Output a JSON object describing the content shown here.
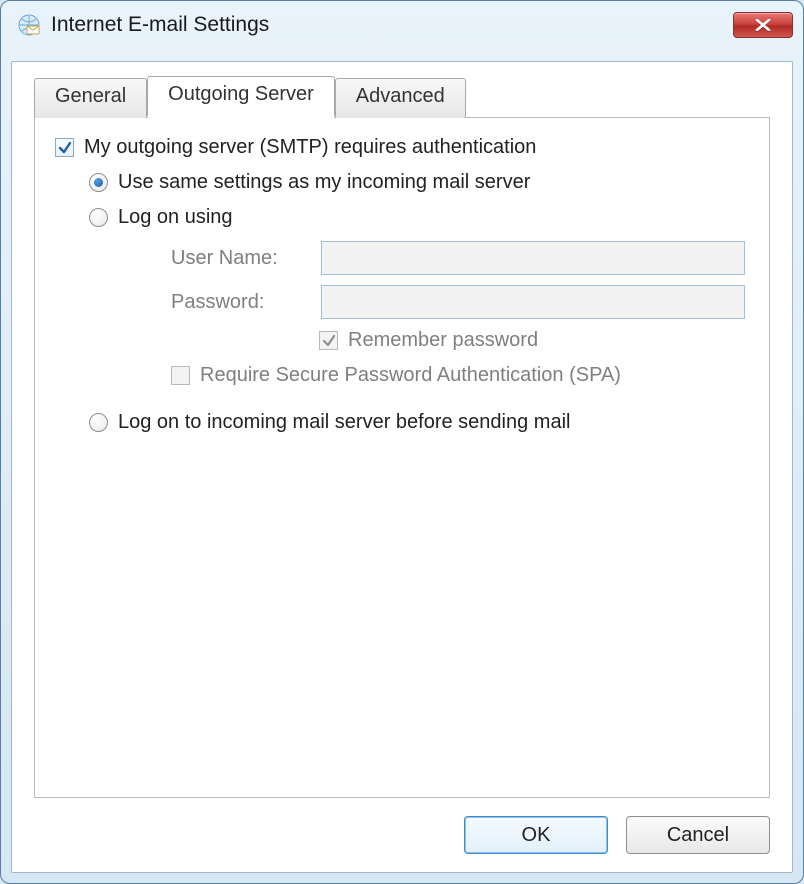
{
  "window": {
    "title": "Internet E-mail Settings"
  },
  "tabs": {
    "general": "General",
    "outgoing": "Outgoing Server",
    "advanced": "Advanced"
  },
  "outgoing_tab": {
    "requires_auth_label": "My outgoing server (SMTP) requires authentication",
    "requires_auth_checked": true,
    "option_same": "Use same settings as my incoming mail server",
    "option_logon": "Log on using",
    "option_logon_before": "Log on to incoming mail server before sending mail",
    "selected_option": "same",
    "username_label": "User Name:",
    "username_value": "",
    "password_label": "Password:",
    "password_value": "",
    "remember_label": "Remember password",
    "remember_checked": true,
    "spa_label": "Require Secure Password Authentication (SPA)",
    "spa_checked": false
  },
  "buttons": {
    "ok": "OK",
    "cancel": "Cancel"
  }
}
